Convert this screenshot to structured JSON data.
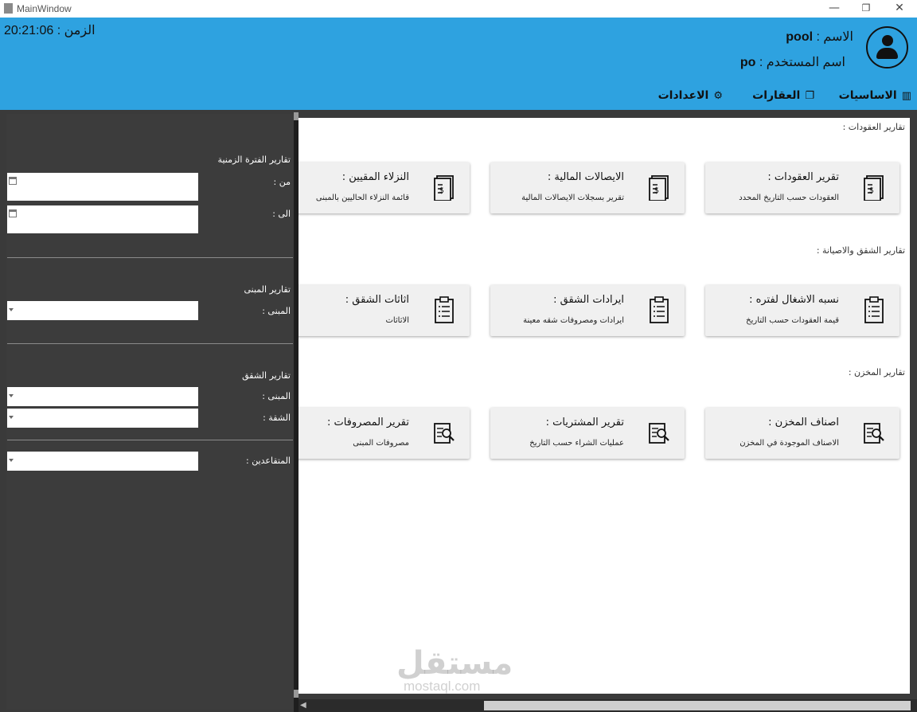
{
  "window": {
    "title": "MainWindow",
    "minimize": "—",
    "maximize": "❐",
    "close": "✕"
  },
  "header": {
    "clock": "الزمن : 20:21:06",
    "name_label": "الاسم : ",
    "name_value": "pool",
    "user_label": "اسم المستخدم : ",
    "user_value": "po",
    "avatar_icon": "user-icon",
    "menu": [
      {
        "label": "الاساسيات",
        "icon": "building-icon",
        "glyph": "▥"
      },
      {
        "label": "العقارات",
        "icon": "documents-icon",
        "glyph": "❐"
      },
      {
        "label": "الاعدادات",
        "icon": "gear-icon",
        "glyph": "⚙"
      }
    ]
  },
  "sections": [
    {
      "title": "تقارير العقودات :",
      "cards": [
        {
          "title": "تقرير العقودات :",
          "subtitle": "العقودات حسب التاريخ المحدد",
          "icon": "invoice-icon"
        },
        {
          "title": "الايصالات المالية  :",
          "subtitle": "تقرير بسجلات الايصالات المالية",
          "icon": "invoice-icon"
        },
        {
          "title": "النزلاء المقيين :",
          "subtitle": "قائمة النزلاء الحاليين بالمبنى",
          "icon": "invoice-icon"
        }
      ]
    },
    {
      "title": "تقارير الشقق والاصيانة :",
      "cards": [
        {
          "title": "نسبه الاشغال لفتره :",
          "subtitle": "قيمة العقودات حسب التاريخ",
          "icon": "clipboard-list-icon"
        },
        {
          "title": "ايرادات الشقق :",
          "subtitle": "ايرادات ومصروفات شقه معينة",
          "icon": "clipboard-list-icon"
        },
        {
          "title": "اثاثات الشقق :",
          "subtitle": "الاثاثات",
          "icon": "clipboard-list-icon"
        }
      ]
    },
    {
      "title": "تقارير المخزن :",
      "cards": [
        {
          "title": "اصناف المخزن :",
          "subtitle": "الاصناف الموجودة في المخزن",
          "icon": "document-search-icon"
        },
        {
          "title": "تقرير المشتريات :",
          "subtitle": "عمليات الشراء حسب التاريخ",
          "icon": "document-search-icon"
        },
        {
          "title": "تقرير المصروفات :",
          "subtitle": "مصروفات المبنى",
          "icon": "document-search-icon"
        }
      ]
    }
  ],
  "side_panel": {
    "period_title": "تقارير الفترة الزمنية",
    "from_label": "من :",
    "to_label": "الى :",
    "from_value": "",
    "to_value": "",
    "building_title": "تقارير المبنى",
    "building_label": "المبنى :",
    "apartment_title": "تقارير الشقق",
    "apartment_building_label": "المبنى :",
    "apartment_label": "الشقة :",
    "retirees_label": "المتقاعدين :"
  },
  "watermark": {
    "main": "مستقل",
    "sub": "mostaql.com"
  },
  "colors": {
    "header": "#2ea2e0",
    "panel": "#3c3c3c",
    "card": "#f0f0f0"
  }
}
